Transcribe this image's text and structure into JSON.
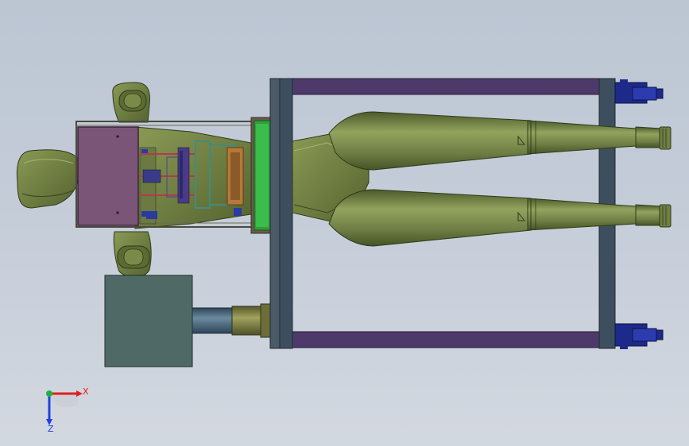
{
  "view": {
    "background_top": "#bcc6d3",
    "background_bottom": "#d3d8e0"
  },
  "model": {
    "colors": {
      "body_green": "#6f7f45",
      "body_green_light": "#93a35e",
      "body_green_dark": "#4c5a2a",
      "frame_purple": "#4e3a6a",
      "frame_slate": "#3d4f5e",
      "hopper_purple": "#7a5577",
      "box_teal": "#4f6a66",
      "shaft_blue": "#3f5870",
      "motor_blue": "#1d2a8a",
      "inner_red": "#b43a4a",
      "inner_teal": "#3f8c80",
      "inner_orange": "#b8783a"
    },
    "parts": [
      "cyclone-upper",
      "cyclone-lower",
      "collector-manifold",
      "support-frame",
      "casters",
      "feed-hopper",
      "fan-housing",
      "inlet-nozzle",
      "motor-box",
      "drive-shaft"
    ]
  },
  "triad": {
    "x_label": "X",
    "z_label": "Z",
    "x_color": "#e02020",
    "y_color": "#20b040",
    "z_color": "#2040e0"
  }
}
